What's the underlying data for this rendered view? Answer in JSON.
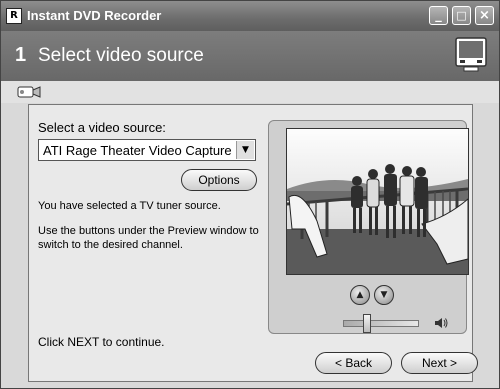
{
  "window": {
    "title": "Instant DVD Recorder",
    "controls": {
      "minimize": "_",
      "maximize": "□",
      "close": "×"
    }
  },
  "header": {
    "step_number": "1",
    "step_title": "Select video source"
  },
  "source": {
    "label": "Select a video source:",
    "selected": "ATI Rage Theater Video Capture",
    "options_button": "Options",
    "info": "You have selected a TV tuner source.",
    "hint": "Use the buttons under the Preview window to switch to the desired channel."
  },
  "preview": {
    "channel_up": "▲",
    "channel_down": "▼",
    "volume_level": 0.3
  },
  "footer": {
    "instruction": "Click NEXT to continue.",
    "back_button": "< Back",
    "next_button": "Next >"
  },
  "icons": {
    "app": "app-icon",
    "tv": "tv-monitor-icon",
    "camera": "video-camera-icon",
    "speaker": "speaker-icon"
  }
}
